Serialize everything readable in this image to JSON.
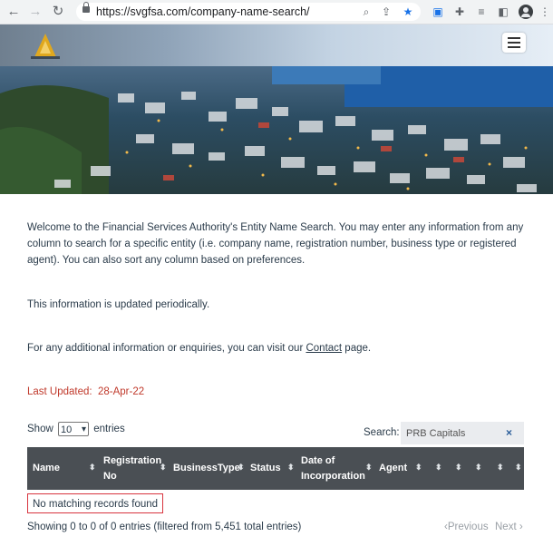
{
  "browser": {
    "url": "https://svgfsa.com/company-name-search/"
  },
  "site": {
    "menu_icon": "hamburger-menu-icon"
  },
  "content": {
    "intro": "Welcome to the Financial Services Authority's Entity Name Search. You may enter any information from any column to search for a specific entity (i.e. company name, registration number, business type or registered agent). You can also sort any column based on preferences.",
    "updated_info": "This information is updated periodically.",
    "contact_prefix": "For any additional information or enquiries, you can visit our ",
    "contact_link": "Contact",
    "contact_suffix": " page.",
    "last_updated_label": "Last Updated:",
    "last_updated_value": "28-Apr-22"
  },
  "table_controls": {
    "show_label": "Show",
    "entries_value": "10",
    "entries_label": "entries",
    "search_label": "Search:",
    "search_value": "PRB Capitals",
    "clear_symbol": "×"
  },
  "table": {
    "columns": [
      {
        "label": "Name"
      },
      {
        "label": "Registration No"
      },
      {
        "label": "BusinessType"
      },
      {
        "label": "Status"
      },
      {
        "label": "Date of Incorporation"
      },
      {
        "label": "Agent"
      },
      {
        "label": ""
      },
      {
        "label": ""
      },
      {
        "label": ""
      },
      {
        "label": ""
      }
    ],
    "sort_symbol": "⬍",
    "empty_message": "No matching records found"
  },
  "footer": {
    "showing": "Showing 0 to 0 of 0 entries (filtered from 5,451 total entries)",
    "previous": "Previous",
    "next": "Next"
  },
  "colors": {
    "accent_red": "#c0392b",
    "header_dark": "#4a4f54",
    "highlight_border": "#d8343e"
  }
}
